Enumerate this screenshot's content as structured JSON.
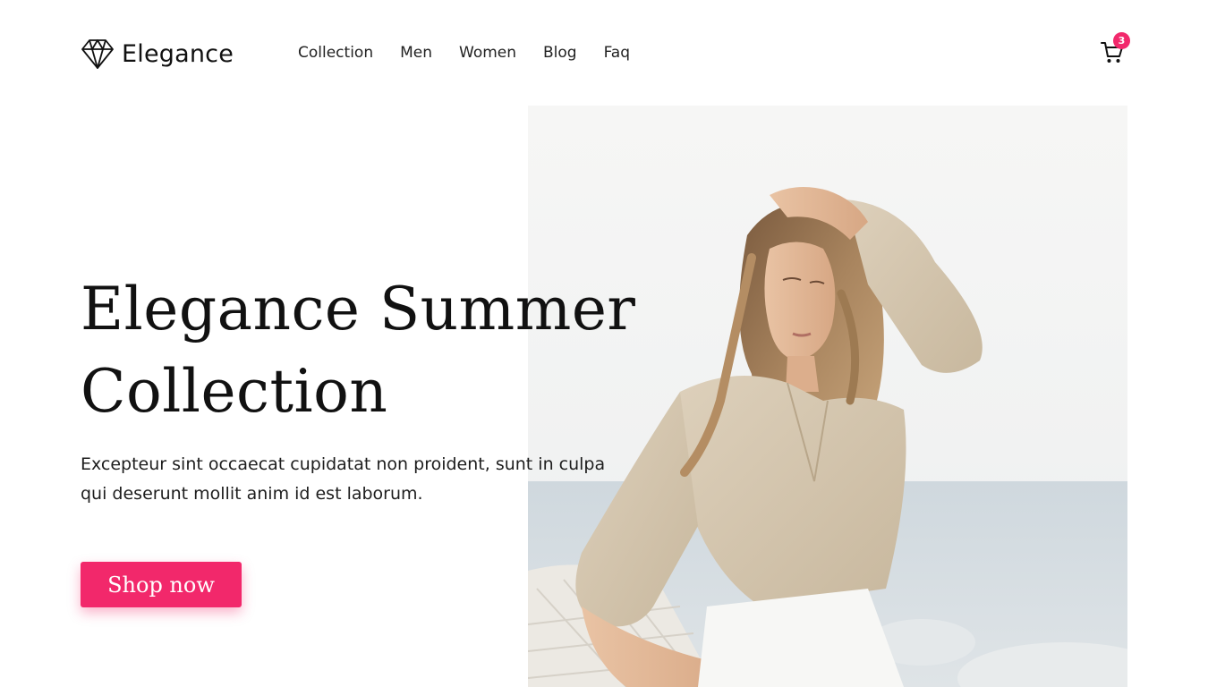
{
  "brand": {
    "name": "Elegance",
    "icon": "diamond-icon"
  },
  "nav": {
    "items": [
      {
        "label": "Collection"
      },
      {
        "label": "Men"
      },
      {
        "label": "Women"
      },
      {
        "label": "Blog"
      },
      {
        "label": "Faq"
      }
    ]
  },
  "cart": {
    "icon": "shopping-cart-icon",
    "count": "3",
    "badge_color": "#f2296c"
  },
  "hero": {
    "title_line1": "Elegance Summer",
    "title_line2": "Collection",
    "description": "Excepteur sint occaecat cupidatat non proident, sunt in culpa qui deserunt mollit anim id est laborum.",
    "cta_label": "Shop now",
    "accent_color": "#f2286b"
  }
}
